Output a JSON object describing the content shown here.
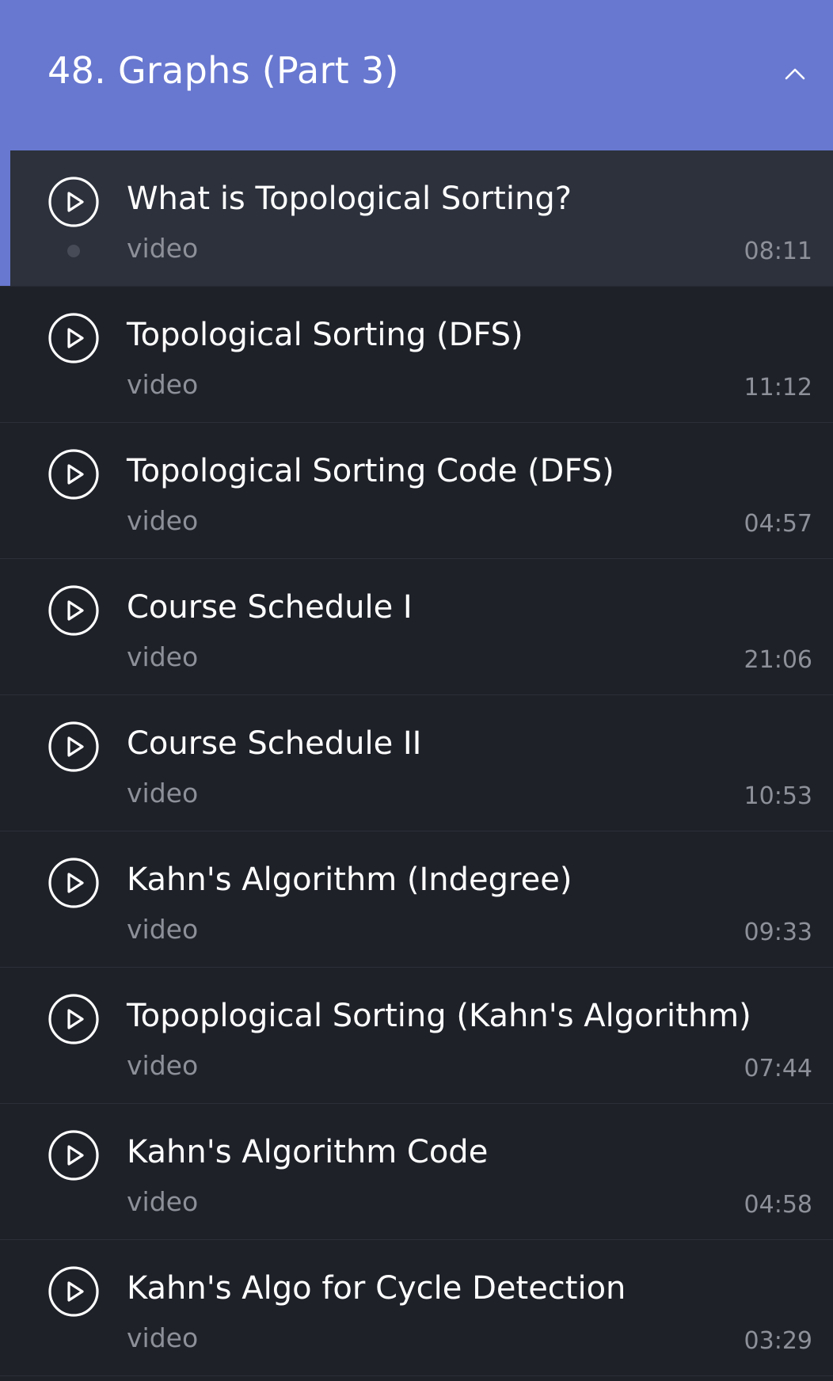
{
  "section": {
    "title": "48. Graphs (Part 3)",
    "collapse_icon": "chevron-up-icon",
    "accent_color": "#6878d0"
  },
  "lessons": [
    {
      "title": "What is Topological Sorting?",
      "type": "video",
      "duration": "08:11",
      "active": true
    },
    {
      "title": "Topological Sorting (DFS)",
      "type": "video",
      "duration": "11:12"
    },
    {
      "title": "Topological Sorting Code (DFS)",
      "type": "video",
      "duration": "04:57"
    },
    {
      "title": "Course Schedule I",
      "type": "video",
      "duration": "21:06"
    },
    {
      "title": "Course Schedule II",
      "type": "video",
      "duration": "10:53"
    },
    {
      "title": "Kahn's Algorithm (Indegree)",
      "type": "video",
      "duration": "09:33"
    },
    {
      "title": "Topoplogical Sorting (Kahn's Algorithm)",
      "type": "video",
      "duration": "07:44"
    },
    {
      "title": "Kahn's Algorithm Code",
      "type": "video",
      "duration": "04:58"
    },
    {
      "title": "Kahn's Algo for Cycle Detection",
      "type": "video",
      "duration": "03:29"
    }
  ],
  "icons": {
    "lesson_icon": "play-circle-icon"
  },
  "colors": {
    "background": "#1f2129",
    "active_row": "#2c313c",
    "secondary_text": "#8e9099"
  }
}
